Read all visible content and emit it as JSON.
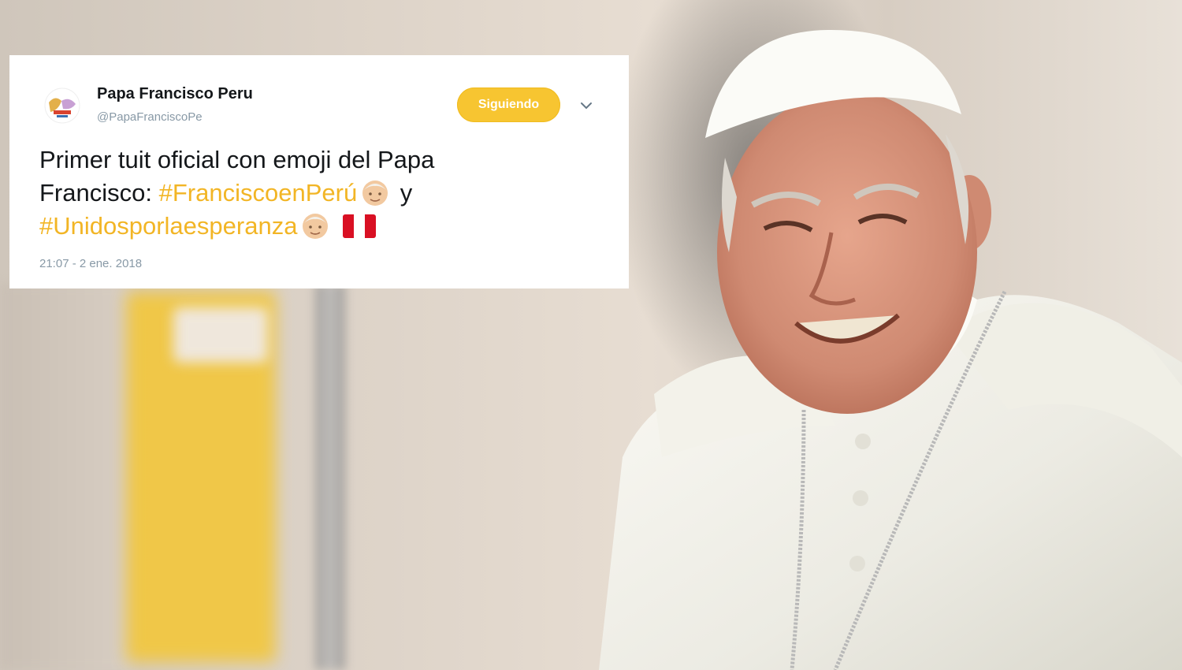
{
  "tweet": {
    "display_name": "Papa Francisco Peru",
    "handle": "@PapaFranciscoPe",
    "follow_label": "Siguiendo",
    "text_line1": "Primer tuit oficial con emoji del Papa",
    "text_line2_prefix": "Francisco: ",
    "hashtag1": "#FranciscoenPerú",
    "text_connector": " y",
    "hashtag2": "#Unidosporlaesperanza",
    "timestamp": "21:07 - 2 ene. 2018"
  },
  "colors": {
    "accent": "#f7c531",
    "hashtag": "#f2b525",
    "muted": "#8899a6",
    "text": "#14171a"
  },
  "icons": {
    "avatar": "papa-francisco-peru-logo",
    "menu": "chevron-down-icon",
    "emoji": "pope-face-emoji",
    "flag": "peru-flag-emoji"
  }
}
